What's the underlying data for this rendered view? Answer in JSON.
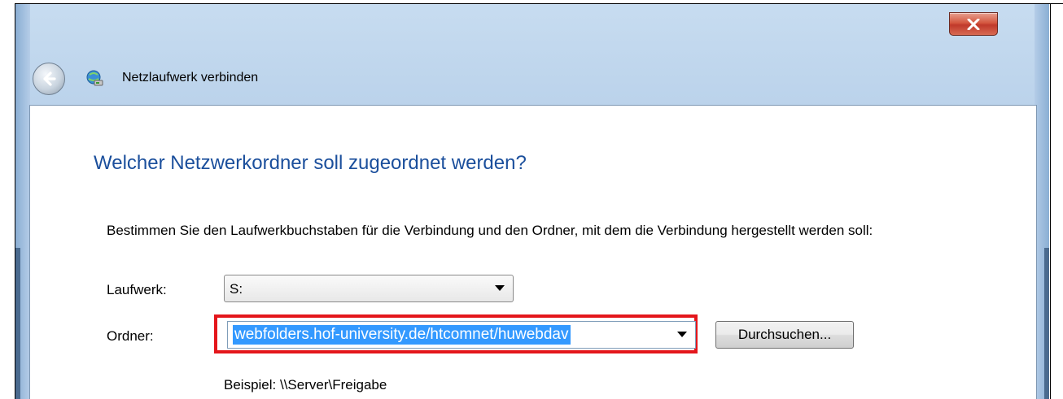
{
  "window": {
    "title": "Netzlaufwerk verbinden",
    "close_glyph": "x"
  },
  "main": {
    "heading": "Welcher Netzwerkordner soll zugeordnet werden?",
    "instructions": "Bestimmen Sie den Laufwerkbuchstaben für die Verbindung und den Ordner, mit dem die Verbindung hergestellt werden soll:",
    "drive_label": "Laufwerk:",
    "drive_value": "S:",
    "folder_label": "Ordner:",
    "folder_value": "webfolders.hof-university.de/htcomnet/huwebdav",
    "browse_label": "Durchsuchen...",
    "example": "Beispiel: \\\\Server\\Freigabe"
  },
  "colors": {
    "heading": "#1b4f9c",
    "highlight": "#e4161b",
    "selection": "#3399ff",
    "close_button": "#c0392b"
  },
  "icons": [
    "back-arrow-icon",
    "network-drive-icon",
    "close-icon",
    "chevron-down-icon"
  ]
}
